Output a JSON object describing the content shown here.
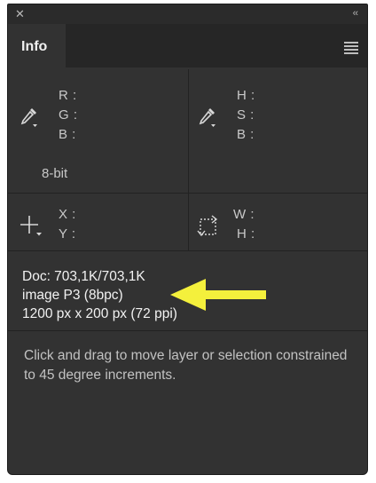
{
  "panel": {
    "tab_label": "Info"
  },
  "color_left": {
    "channels": [
      "R :",
      "G :",
      "B :"
    ],
    "bit_depth": "8-bit"
  },
  "color_right": {
    "channels": [
      "H :",
      "S :",
      "B :"
    ]
  },
  "position": {
    "labels": [
      "X :",
      "Y :"
    ]
  },
  "size": {
    "labels": [
      "W :",
      "H :"
    ]
  },
  "doc": {
    "line1": "Doc: 703,1K/703,1K",
    "line2": "image P3 (8bpc)",
    "line3": "1200 px x 200 px (72 ppi)"
  },
  "hint": {
    "text": "Click and drag to move layer or selection constrained to 45 degree increments."
  },
  "colors": {
    "panel_bg": "#323232",
    "tabbar_bg": "#262626",
    "annotation_arrow": "#f4f03c"
  },
  "icons": [
    "close-icon",
    "collapse-icon",
    "panel-menu-icon",
    "eyedropper-icon",
    "crosshair-icon",
    "selection-size-icon",
    "annotation-arrow"
  ]
}
